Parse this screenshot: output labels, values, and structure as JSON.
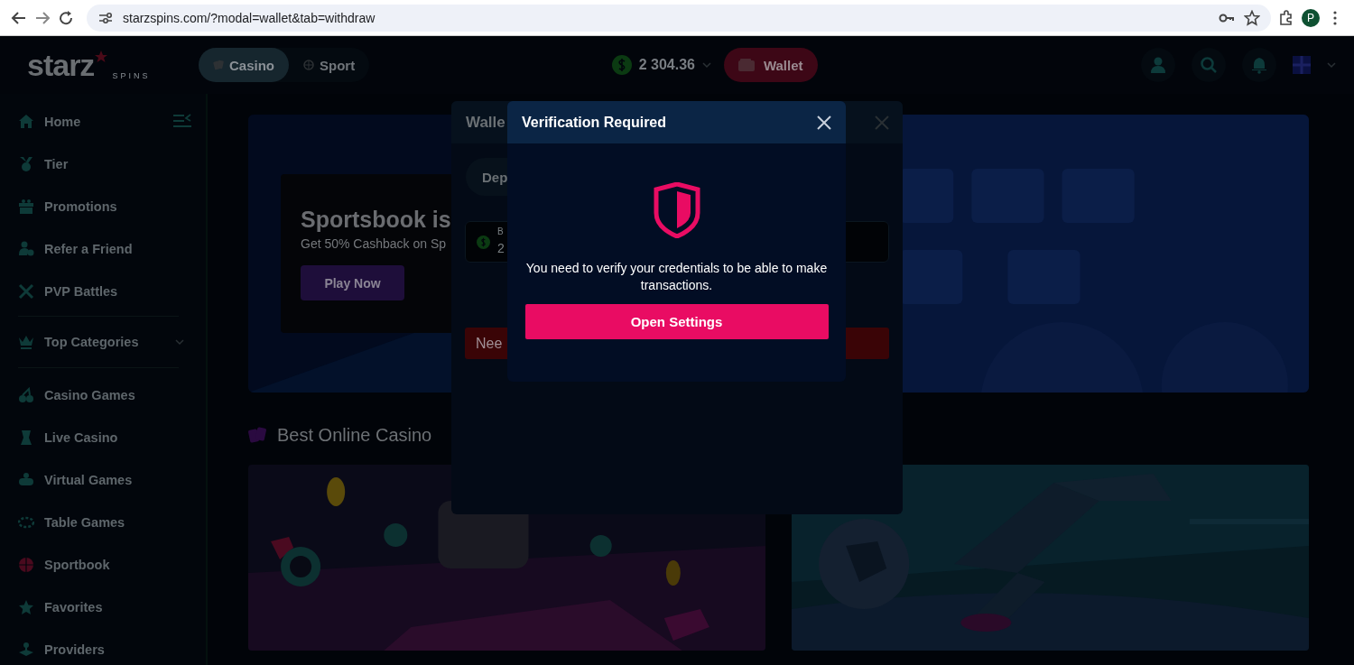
{
  "browser": {
    "url": "starzspins.com/?modal=wallet&tab=withdraw",
    "profile_initial": "P"
  },
  "header": {
    "logo": "starz",
    "logo_sub": "SPINS",
    "tabs": [
      {
        "label": "Casino",
        "selected": true
      },
      {
        "label": "Sport",
        "selected": false
      }
    ],
    "balance": "2 304.36",
    "wallet_button": "Wallet"
  },
  "sidebar": {
    "items": [
      {
        "label": "Home"
      },
      {
        "label": "Tier"
      },
      {
        "label": "Promotions"
      },
      {
        "label": "Refer a Friend"
      },
      {
        "label": "PVP Battles"
      }
    ],
    "category_header": "Top Categories",
    "categories": [
      {
        "label": "Casino Games"
      },
      {
        "label": "Live Casino"
      },
      {
        "label": "Virtual Games"
      },
      {
        "label": "Table Games"
      },
      {
        "label": "Sportbook"
      },
      {
        "label": "Favorites"
      },
      {
        "label": "Providers"
      }
    ]
  },
  "banner": {
    "title": "Sportsbook is",
    "subtitle": "Get 50% Cashback on Sp",
    "button": "Play Now"
  },
  "section_title": "Best Online Casino",
  "wallet_modal": {
    "title": "Walle",
    "tab": "Dep",
    "balance_label": "B",
    "balance_value": "2",
    "notice": "Nee"
  },
  "verification_modal": {
    "title": "Verification Required",
    "message": "You need to verify your credentials to be able to make transactions.",
    "button": "Open Settings"
  }
}
